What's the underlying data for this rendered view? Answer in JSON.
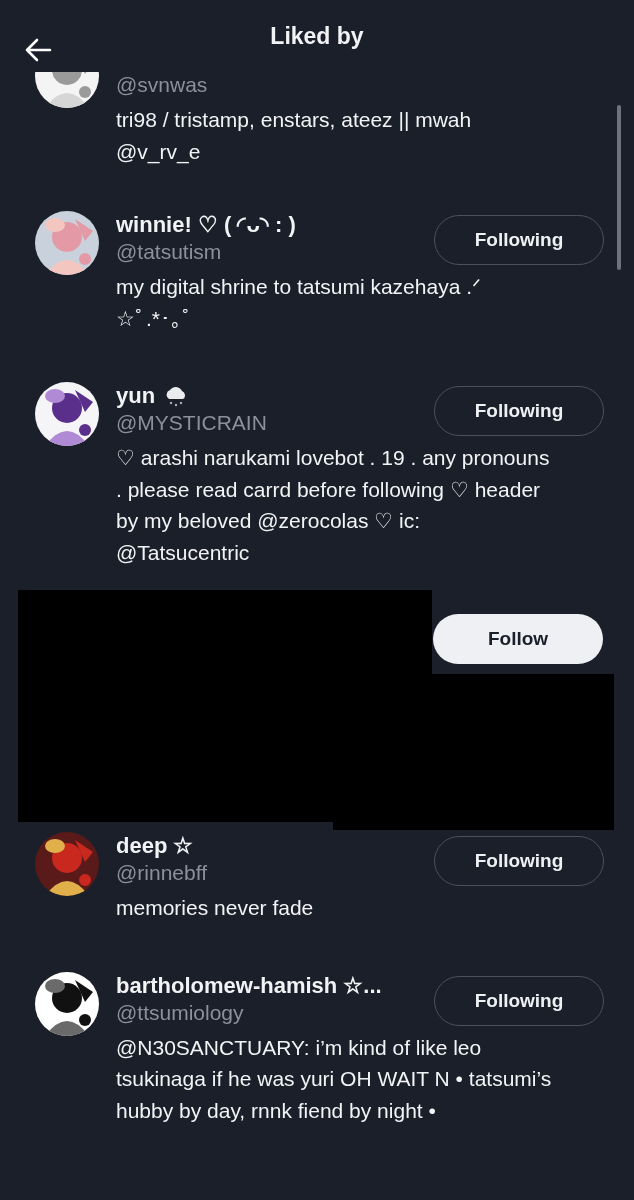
{
  "header": {
    "title": "Liked by"
  },
  "users": [
    {
      "kind": "partial",
      "handle": "@svnwas",
      "bio": "tri98 / tristamp, enstars, ateez || mwah @v_rv_e"
    },
    {
      "kind": "user",
      "name": "winnie! ♡ ( ◜ᴗ◝ : )",
      "handle": "@tatsutism",
      "bio": "my digital shrine to tatsumi kazehaya .ᐟ ☆ﾟ.*･｡ﾟ",
      "button": "Following",
      "following": true
    },
    {
      "kind": "user",
      "name": "yun",
      "cloud": true,
      "handle": "@MYSTICRAIN",
      "bio": "♡ arashi narukami lovebot . 19 . any pronouns . please read carrd before following ♡ header by my beloved @zerocolas ♡ ic: @Tatsucentric",
      "button": "Following",
      "following": true
    },
    {
      "kind": "redacted",
      "button": "Follow",
      "following": false
    },
    {
      "kind": "user",
      "name": "deep ☆",
      "handle": "@rinnebff",
      "bio": "memories never fade",
      "button": "Following",
      "following": true
    },
    {
      "kind": "user",
      "name": "bartholomew-hamish ☆...",
      "handle": "@ttsumiology",
      "bio": "@N30SANCTUARY: i’m kind of like leo tsukinaga if he was yuri OH WAIT N • tatsumi’s hubby by day, rnnk fiend by night •",
      "button": "Following",
      "following": true
    }
  ]
}
